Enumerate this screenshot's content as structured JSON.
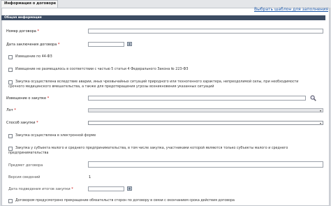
{
  "tab": {
    "label": "Информация о договоре"
  },
  "template_link": "Выбрать шаблон для заполнения",
  "section_title": "Общая информация",
  "fields": {
    "contract_number": "Номер договора",
    "contract_date": "Дата заключения договора",
    "notice_label": "Извещение о закупке",
    "lot_label": "Лот",
    "method_label": "Способ закупки",
    "subject_label": "Предмет договора",
    "version_label": "Версия сведений",
    "version_value": "1",
    "summary_date_label": "Дата подведения итогов закупки",
    "required_mark": "*"
  },
  "checkboxes": {
    "cb1": "Извещение по 44-ФЗ",
    "cb2": "Извещение не размещалось в соответствии с частью 5 статьи 4 Федерального Закона № 223-ФЗ",
    "cb3_line1": "Закупка осуществлена вследствие аварии, иных чрезвычайных ситуаций природного или техногенного характера, непреодолимой силы, при необходимости",
    "cb3_line2": "срочного медицинского вмешательства, а также для предотвращения угрозы возникновения указанных ситуаций",
    "cb4": "Закупка осуществлена в электронной форме",
    "cb5_line1": "Закупка у субъекта малого и среднего предпринимательства, в том числе закупка, участниками которой являются только субъекты малого и среднего",
    "cb5_line2": "предпринимательства",
    "cb6": "Договором предусмотрено прекращение обязательств сторон по договору в связи с окончанием срока действия договора"
  },
  "icons": {
    "calendar": "calendar-icon",
    "search": "search-icon",
    "dropdown": "chevron-down-icon"
  }
}
